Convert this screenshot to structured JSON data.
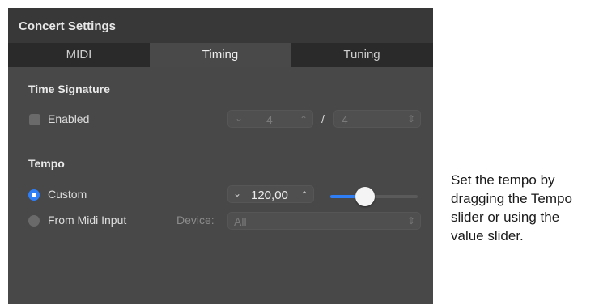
{
  "window": {
    "title": "Concert Settings"
  },
  "tabs": [
    {
      "label": "MIDI",
      "active": false
    },
    {
      "label": "Timing",
      "active": true
    },
    {
      "label": "Tuning",
      "active": false
    }
  ],
  "time_signature": {
    "heading": "Time Signature",
    "enabled_label": "Enabled",
    "enabled": false,
    "numerator": "4",
    "separator": "/",
    "denominator": "4"
  },
  "tempo": {
    "heading": "Tempo",
    "custom_label": "Custom",
    "custom_selected": true,
    "value": "120,00",
    "slider_level": 0.4,
    "midi_label": "From Midi Input",
    "device_label": "Device:",
    "device_value": "All"
  },
  "callout": {
    "lines": [
      "Set the tempo by",
      "dragging the Tempo",
      "slider or using the",
      "value slider."
    ]
  },
  "icons": {
    "chevron_down": "⌄",
    "chevron_up": "⌃",
    "updown": "⇕"
  },
  "colors": {
    "accent": "#2f7ef6",
    "window": "#484848",
    "titlebar": "#383838"
  }
}
